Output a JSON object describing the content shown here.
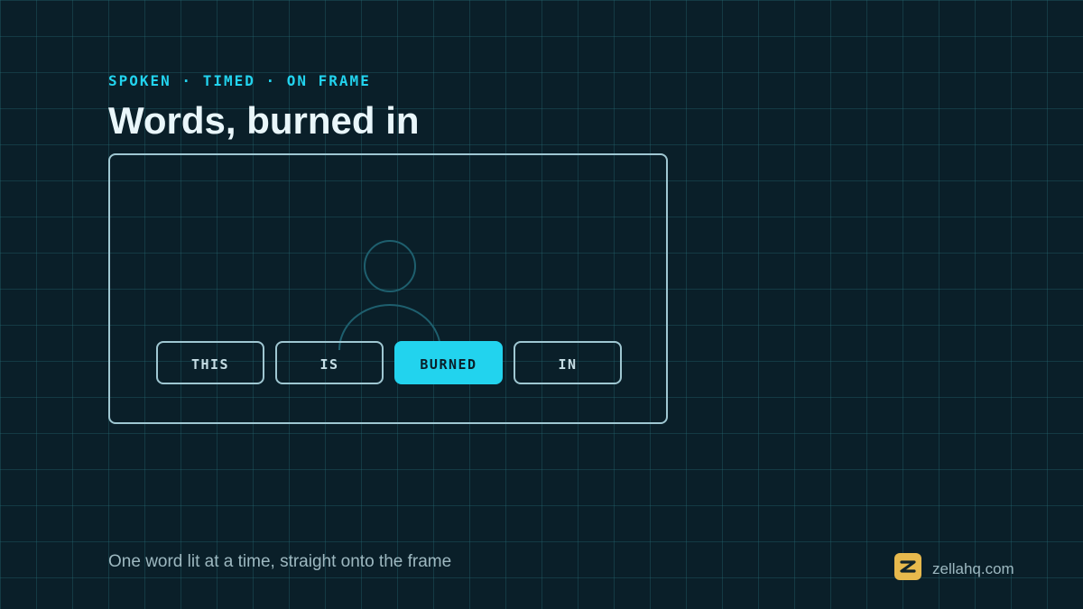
{
  "eyebrow": "SPOKEN · TIMED · ON FRAME",
  "title": "Words, burned in",
  "preview": {
    "icon": "person-silhouette-icon",
    "words": [
      {
        "label": "THIS",
        "active": false
      },
      {
        "label": "IS",
        "active": false
      },
      {
        "label": "BURNED",
        "active": true
      },
      {
        "label": "IN",
        "active": false
      }
    ]
  },
  "caption": "One word lit at a time, straight onto the frame",
  "brand": {
    "logo_icon": "z-logo-icon",
    "site": "zellahq.com"
  },
  "colors": {
    "background": "#0a1f29",
    "grid": "#266e76",
    "accent": "#22d3ee",
    "frame_border": "#9fc7d2",
    "title": "#e9f6fa",
    "muted_text": "#9db8c0",
    "logo": "#e7b94d"
  }
}
